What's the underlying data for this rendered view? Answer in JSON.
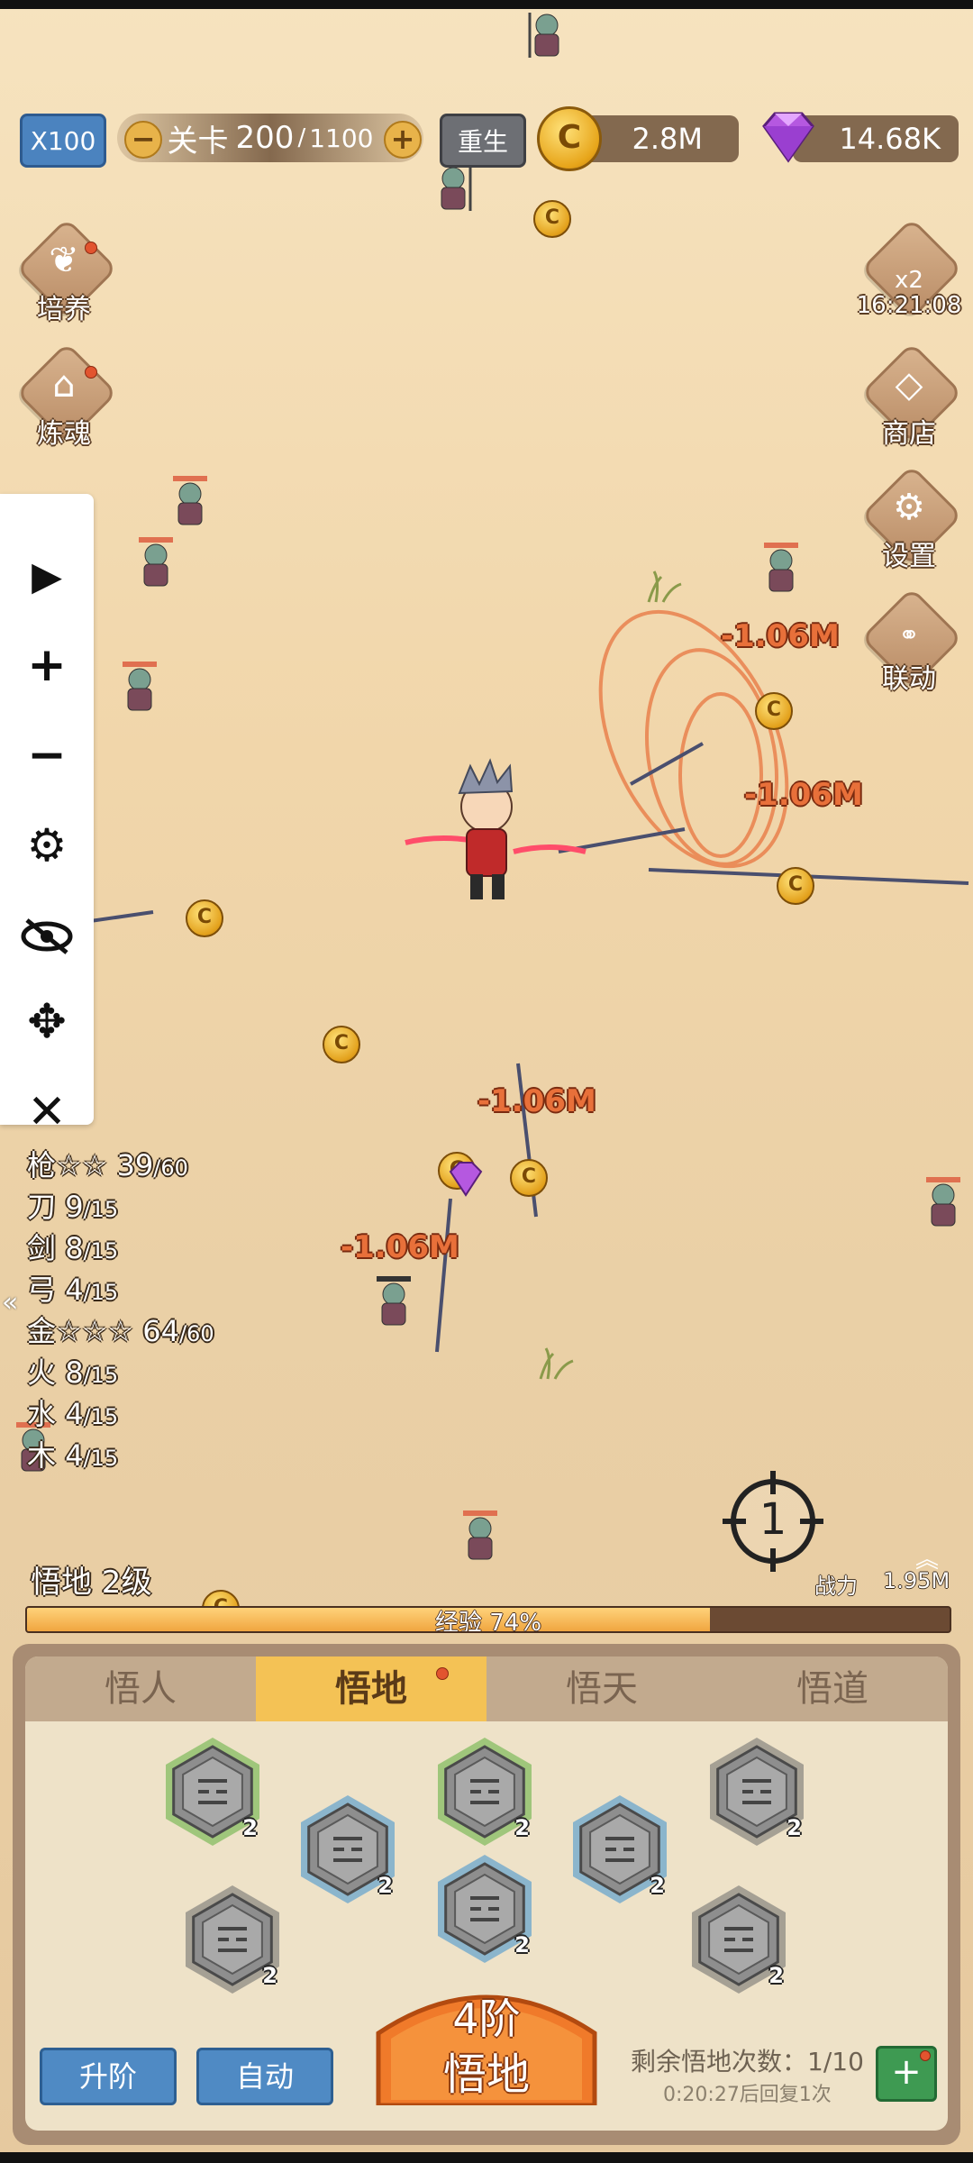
{
  "top": {
    "speed_label": "X100",
    "stage_label": "关卡",
    "stage_current": "200",
    "stage_sep": "/",
    "stage_total": "1100",
    "stage_minus": "−",
    "stage_plus": "+",
    "rebirth_label": "重生",
    "gold_icon_glyph": "C",
    "gold_value": "2.8M",
    "gem_value": "14.68K"
  },
  "left_menu": [
    {
      "label": "培养",
      "icon": "sprout-icon"
    },
    {
      "label": "炼魂",
      "icon": "house-icon"
    }
  ],
  "right_menu": {
    "bonus_badge": "x2",
    "bonus_timer": "16:21:08",
    "items": [
      {
        "label": "商店",
        "icon": "diamond-shop-icon"
      },
      {
        "label": "设置",
        "icon": "gear-icon"
      },
      {
        "label": "联动",
        "icon": "link-icon"
      }
    ]
  },
  "controls": [
    {
      "name": "play",
      "glyph": "▶"
    },
    {
      "name": "plus",
      "glyph": "+"
    },
    {
      "name": "minus",
      "glyph": "−"
    },
    {
      "name": "settings",
      "glyph": "⚙"
    },
    {
      "name": "hide",
      "glyph": "👁"
    },
    {
      "name": "move",
      "glyph": "✥"
    },
    {
      "name": "close",
      "glyph": "✕"
    }
  ],
  "stats": [
    {
      "name": "枪☆☆",
      "value": "39",
      "max": "/60"
    },
    {
      "name": "刀",
      "value": "9",
      "max": "/15"
    },
    {
      "name": "剑",
      "value": "8",
      "max": "/15"
    },
    {
      "name": "弓",
      "value": "4",
      "max": "/15"
    },
    {
      "name": "金☆☆☆",
      "value": "64",
      "max": "/60"
    },
    {
      "name": "火",
      "value": "8",
      "max": "/15"
    },
    {
      "name": "水",
      "value": "4",
      "max": "/15"
    },
    {
      "name": "木",
      "value": "4",
      "max": "/15"
    }
  ],
  "collapse_glyph": "«",
  "damage": [
    "-1.06M",
    "-1.06M",
    "-1.06M",
    "-1.06M"
  ],
  "crosshair_number": "1",
  "level": {
    "title": "悟地 2级",
    "power_label": "战力",
    "power_value": "1.95M",
    "power_arrow": "︽",
    "exp_label": "经验 74%",
    "exp_percent": 74
  },
  "tabs": [
    "悟人",
    "悟地",
    "悟天",
    "悟道"
  ],
  "active_tab": 1,
  "hexes": [
    {
      "color": "green",
      "count": "2"
    },
    {
      "color": "blue",
      "count": "2"
    },
    {
      "color": "green",
      "count": "2"
    },
    {
      "color": "blue",
      "count": "2"
    },
    {
      "color": "gray",
      "count": "2"
    },
    {
      "color": "gray",
      "count": "2"
    },
    {
      "color": "blue",
      "count": "2"
    },
    {
      "color": "gray",
      "count": "2"
    }
  ],
  "buttons": {
    "upgrade": "升阶",
    "auto": "自动",
    "big_line1": "4阶",
    "big_line2": "悟地",
    "plus": "+"
  },
  "remain": {
    "label": "剩余悟地次数：",
    "value": "1/10",
    "recover": "0:20:27后回复1次"
  },
  "colors": {
    "green": "#5fae3c",
    "blue": "#3b8fd0",
    "gray": "#6a6a6a",
    "accent": "#f4c255"
  }
}
